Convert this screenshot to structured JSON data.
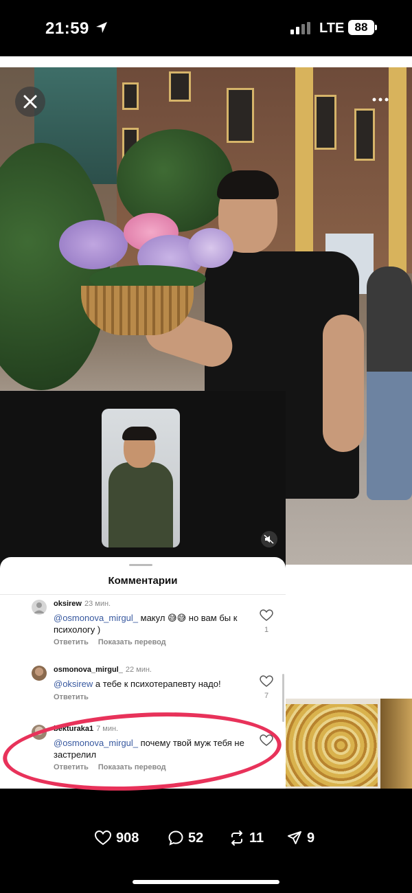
{
  "status_bar": {
    "time": "21:59",
    "network": "LTE",
    "battery": "88"
  },
  "embedded": {
    "sheet_title": "Комментарии",
    "comments": [
      {
        "user": "oksirew",
        "ago": "23 мин.",
        "mention": "@osmonova_mirgul_",
        "text": " макул 😅😅 но вам бы к психологу )",
        "reply": "Ответить",
        "translate": "Показать перевод",
        "likes": "1"
      },
      {
        "user": "osmonova_mirgul_",
        "ago": "22 мин.",
        "mention": "@oksirew",
        "text": " а тебе к психотерапевту надо!",
        "reply": "Ответить",
        "likes": "7"
      },
      {
        "user": "bekturaka1",
        "ago": "7 мин.",
        "mention": "@osmonova_mirgul_",
        "text": " почему твой муж тебя не застрелил",
        "reply": "Ответить",
        "translate": "Показать перевод"
      }
    ]
  },
  "post_stats": {
    "likes": "908",
    "comments": "52",
    "reposts": "11",
    "shares": "9"
  },
  "colors": {
    "accent_circle": "#e8325a",
    "mention": "#37589f"
  }
}
